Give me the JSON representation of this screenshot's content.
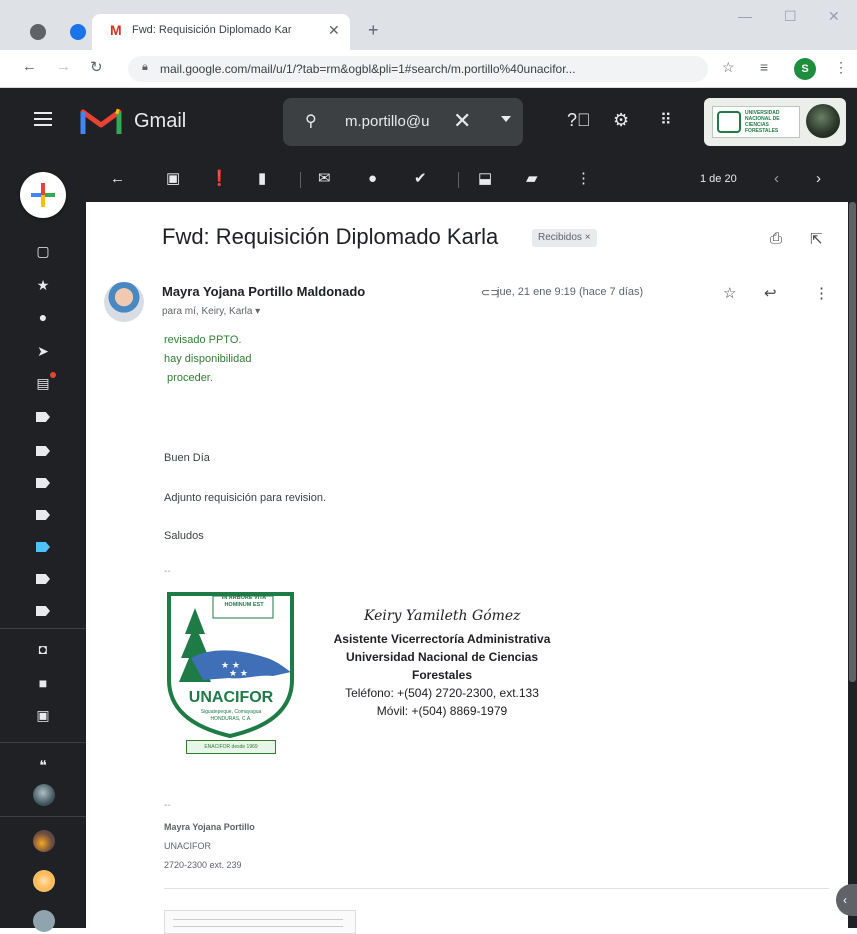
{
  "browser": {
    "tab_title": "Fwd: Requisición Diplomado Kar",
    "tab_favicon": "M",
    "url": "mail.google.com/mail/u/1/?tab=rm&ogbl&pli=1#search/m.portillo%40unacifor...",
    "profile_initial": "S",
    "new_tab_icon": "+",
    "tab_close_icon": "✕"
  },
  "gmail": {
    "app_name": "Gmail",
    "search_query": "m.portillo@u",
    "pager": "1 de 20"
  },
  "message": {
    "subject": "Fwd: Requisición Diplomado Karla",
    "label": "Recibidos ×",
    "sender_name": "Mayra Yojana Portillo Maldonado",
    "recipients": "para mí, Keiry, Karla ▾",
    "date": "jue, 21 ene 9:19 (hace 7 días)",
    "reply_lines": [
      "revisado PPTO.",
      "hay disponibilidad",
      " proceder."
    ],
    "body": {
      "greeting": "Buen Día",
      "line1": "Adjunto requisición para revision.",
      "closing": "Saludos",
      "sig_dash": "--"
    },
    "signature_block": {
      "name": "Keiry Yamileth Gómez",
      "title": "Asistente Vicerrectoría Administrativa",
      "org_line1": "Universidad Nacional de Ciencias",
      "org_line2": "Forestales",
      "phone": "Teléfono: +(504) 2720-2300, ext.133",
      "mobile": "Móvil: +(504) 8869-1979",
      "emblem_motto": "IN ARBORE VITA HOMINUM EST",
      "emblem_name": "UNACIFOR",
      "emblem_place": "Siguatepeque, Comayagua",
      "emblem_country": "HONDURAS, C.A.",
      "emblem_since": "ENACIFOR desde 1969"
    },
    "signature2": {
      "dash": "--",
      "name": "Mayra Yojana Portillo",
      "org": "UNACIFOR",
      "phone": "2720-2300 ext. 239"
    }
  },
  "org_logo_text": "UNIVERSIDAD NACIONAL DE CIENCIAS FORESTALES",
  "colors": {
    "dark_bg": "#202124",
    "reply_green": "#2e7d32",
    "emblem_green": "#1e7b46"
  },
  "icons": [
    "menu-icon",
    "search-icon",
    "help-icon",
    "settings-icon",
    "apps-icon",
    "back-arrow-icon",
    "archive-icon",
    "spam-icon",
    "delete-icon",
    "mark-unread-icon",
    "snooze-icon",
    "add-task-icon",
    "move-to-icon",
    "label-icon",
    "more-vert-icon",
    "print-icon",
    "open-new-window-icon",
    "star-icon",
    "reply-icon",
    "attachment-icon"
  ]
}
